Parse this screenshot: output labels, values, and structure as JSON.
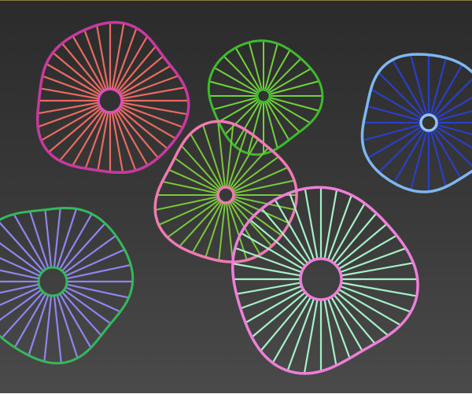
{
  "viewport": {
    "frame_color": "#8a7d3a"
  },
  "objects": [
    {
      "id": "pink-red",
      "spokes": 36,
      "ring": "#c8399f",
      "spoke": "#ea6a5f",
      "hub": "#e04fb8"
    },
    {
      "id": "green",
      "spokes": 24,
      "ring": "#3dbb2d",
      "spoke": "#6fd33a",
      "hub": "#3dbb2d"
    },
    {
      "id": "blue",
      "spokes": 24,
      "ring": "#7fb7ee",
      "spoke": "#2a3fc8",
      "hub": "#8fc3f2"
    },
    {
      "id": "pink-lime",
      "spokes": 30,
      "ring": "#f07ab2",
      "spoke": "#79c93a",
      "hub": "#f07ab2"
    },
    {
      "id": "green-violet",
      "spokes": 30,
      "ring": "#35b85c",
      "spoke": "#8d86f0",
      "hub": "#35b85c"
    },
    {
      "id": "pink-mint",
      "spokes": 36,
      "ring": "#ee7fd8",
      "spoke": "#a6f0c6",
      "hub": "#ee7fd8"
    }
  ]
}
